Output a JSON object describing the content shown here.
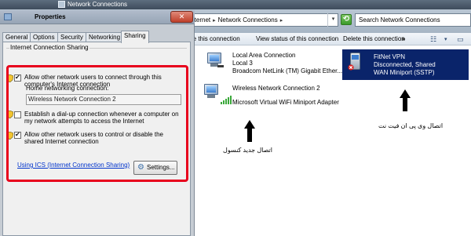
{
  "explorer": {
    "title": "Network Connections",
    "address": {
      "crumbs": [
        "Internet",
        "Network Connections"
      ],
      "separator": "▸"
    },
    "search_placeholder": "Search Network Connections",
    "commands": {
      "this_connection": "me this connection",
      "view_status": "View status of this connection",
      "delete": "Delete this connection",
      "more": "»"
    },
    "connections": [
      {
        "name": "Local Area Connection",
        "line2": "Local  3",
        "line3": "Broadcom NetLink (TM) Gigabit Ether..."
      },
      {
        "name": "Wireless Network Connection 2",
        "line2": "Microsoft Virtual WiFi Miniport Adapter"
      },
      {
        "name": "FitNet VPN",
        "line2": "Disconnected, Shared",
        "line3": "WAN Miniport (SSTP)"
      }
    ],
    "annotations": {
      "new_connection": "اتصال جدید کنسول",
      "vpn_connection": "اتصال وی پی ان فیت نت"
    },
    "colors": {
      "selection": "#0a246a",
      "accent_red": "#e8001c"
    }
  },
  "dialog": {
    "title": "Properties",
    "close": "✕",
    "tabs": [
      "General",
      "Options",
      "Security",
      "Networking",
      "Sharing"
    ],
    "active_tab": "Sharing",
    "group_title": "Internet Connection Sharing",
    "allow_share": {
      "checked": true,
      "line1": "Allow other network users to connect through this",
      "line2": "computer's Internet connection"
    },
    "home_network_label": "Home networking connection:",
    "home_network_value": "Wireless Network Connection 2",
    "dialup": {
      "checked": false,
      "line1": "Establish a dial-up connection whenever a computer on",
      "line2": "my network attempts to access the Internet"
    },
    "allow_control": {
      "checked": true,
      "line1": "Allow other network users to control or disable the",
      "line2": "shared Internet connection"
    },
    "ics_link": "Using ICS (Internet Connection Sharing)",
    "settings_button": "Settings..."
  }
}
